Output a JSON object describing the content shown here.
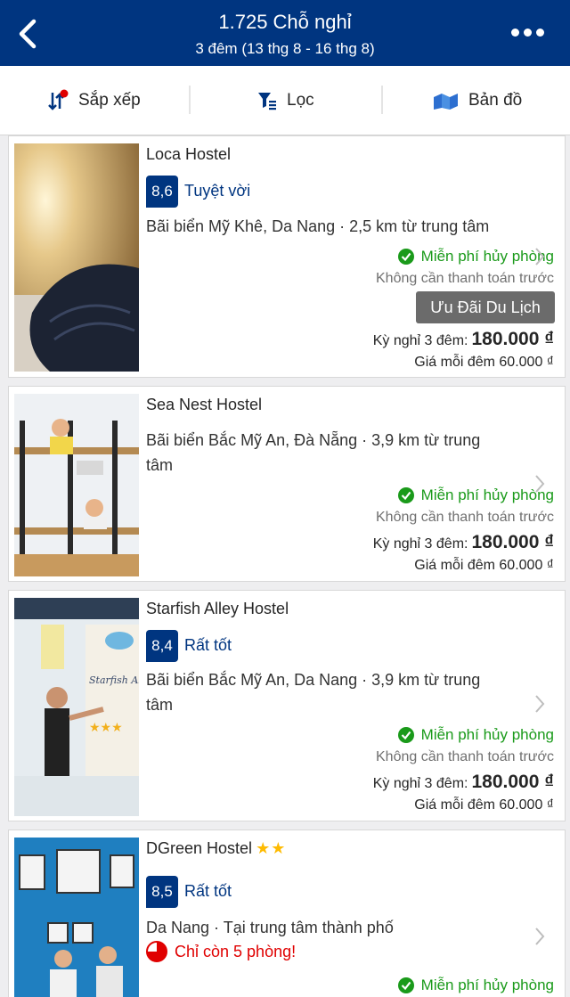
{
  "header": {
    "title": "1.725 Chỗ nghỉ",
    "subtitle": "3 đêm (13 thg 8 - 16 thg 8)"
  },
  "toolbar": {
    "sort_label": "Sắp xếp",
    "filter_label": "Lọc",
    "map_label": "Bản đồ"
  },
  "listings": [
    {
      "name": "Loca Hostel",
      "score": "8,6",
      "score_word": "Tuyệt vời",
      "location": "Bãi biển Mỹ Khê, Da Nang · 2,5 km từ trung tâm",
      "free_cancel": "Miễn phí hủy phòng",
      "no_prepay": "Không cần thanh toán trước",
      "deal": "Ưu Đãi Du Lịch",
      "stay_label": "Kỳ nghỉ 3 đêm:",
      "price": "180.000 ₫",
      "per_night": "Giá mỗi đêm 60.000 ₫"
    },
    {
      "name": "Sea Nest Hostel",
      "location": "Bãi biển Bắc Mỹ An, Đà Nẵng · 3,9 km từ trung tâm",
      "free_cancel": "Miễn phí hủy phòng",
      "no_prepay": "Không cần thanh toán trước",
      "stay_label": "Kỳ nghỉ 3 đêm:",
      "price": "180.000 ₫",
      "per_night": "Giá mỗi đêm 60.000 ₫"
    },
    {
      "name": "Starfish Alley Hostel",
      "score": "8,4",
      "score_word": "Rất tốt",
      "location": "Bãi biển Bắc Mỹ An, Da Nang · 3,9 km từ trung tâm",
      "free_cancel": "Miễn phí hủy phòng",
      "no_prepay": "Không cần thanh toán trước",
      "stay_label": "Kỳ nghỉ 3 đêm:",
      "price": "180.000 ₫",
      "per_night": "Giá mỗi đêm 60.000 ₫",
      "photo_sign": "Starfish Alley Hostel"
    },
    {
      "name": "DGreen Hostel",
      "stars": "★★",
      "score": "8,5",
      "score_word": "Rất tốt",
      "location": "Da Nang · Tại trung tâm thành phố",
      "urgency": "Chỉ còn 5 phòng!",
      "free_cancel": "Miễn phí hủy phòng"
    }
  ],
  "colors": {
    "brand_blue": "#003580",
    "free_green": "#1a9a1a",
    "urgent_red": "#e00000",
    "star_yellow": "#febb02",
    "deal_gray": "#6b6b6b"
  },
  "icons": [
    "back-arrow-icon",
    "more-dots-icon",
    "sort-icon",
    "filter-icon",
    "map-icon",
    "check-circle-icon",
    "chevron-right-icon",
    "clock-icon"
  ]
}
